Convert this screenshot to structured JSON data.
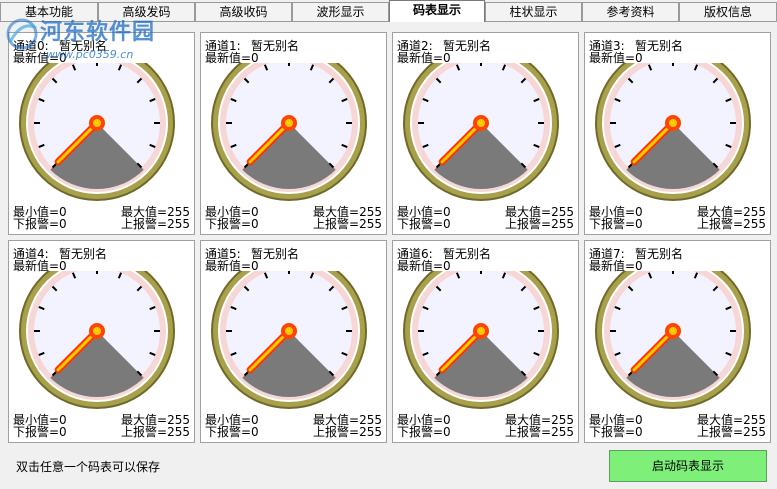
{
  "tabs": [
    {
      "label": "基本功能",
      "active": false
    },
    {
      "label": "高级发码",
      "active": false
    },
    {
      "label": "高级收码",
      "active": false
    },
    {
      "label": "波形显示",
      "active": false
    },
    {
      "label": "码表显示",
      "active": true
    },
    {
      "label": "柱状显示",
      "active": false
    },
    {
      "label": "参考资料",
      "active": false
    },
    {
      "label": "版权信息",
      "active": false
    }
  ],
  "watermark": {
    "title": "河东软件园",
    "url": "www.pc0359.cn"
  },
  "gauges": [
    {
      "channel": "通道0:",
      "alias": "暂无别名",
      "latest": "最新值=0",
      "min": "最小值=0",
      "max": "最大值=255",
      "low_alarm": "下报警=0",
      "high_alarm": "上报警=255",
      "value": 0
    },
    {
      "channel": "通道1:",
      "alias": "暂无别名",
      "latest": "最新值=0",
      "min": "最小值=0",
      "max": "最大值=255",
      "low_alarm": "下报警=0",
      "high_alarm": "上报警=255",
      "value": 0
    },
    {
      "channel": "通道2:",
      "alias": "暂无别名",
      "latest": "最新值=0",
      "min": "最小值=0",
      "max": "最大值=255",
      "low_alarm": "下报警=0",
      "high_alarm": "上报警=255",
      "value": 0
    },
    {
      "channel": "通道3:",
      "alias": "暂无别名",
      "latest": "最新值=0",
      "min": "最小值=0",
      "max": "最大值=255",
      "low_alarm": "下报警=0",
      "high_alarm": "上报警=255",
      "value": 0
    },
    {
      "channel": "通道4:",
      "alias": "暂无别名",
      "latest": "最新值=0",
      "min": "最小值=0",
      "max": "最大值=255",
      "low_alarm": "下报警=0",
      "high_alarm": "上报警=255",
      "value": 0
    },
    {
      "channel": "通道5:",
      "alias": "暂无别名",
      "latest": "最新值=0",
      "min": "最小值=0",
      "max": "最大值=255",
      "low_alarm": "下报警=0",
      "high_alarm": "上报警=255",
      "value": 0
    },
    {
      "channel": "通道6:",
      "alias": "暂无别名",
      "latest": "最新值=0",
      "min": "最小值=0",
      "max": "最大值=255",
      "low_alarm": "下报警=0",
      "high_alarm": "上报警=255",
      "value": 0
    },
    {
      "channel": "通道7:",
      "alias": "暂无别名",
      "latest": "最新值=0",
      "min": "最小值=0",
      "max": "最大值=255",
      "low_alarm": "下报警=0",
      "high_alarm": "上报警=255",
      "value": 0
    }
  ],
  "status": {
    "hint": "双击任意一个码表可以保存",
    "start_button": "启动码表显示"
  },
  "colors": {
    "bezel": "#a8a04a",
    "bezel_dark": "#6e6a2a",
    "dial_face": "#f3f3ff",
    "alarm_band": "#f7d6d6",
    "needle": "#f07000",
    "needle_center": "#ffcc00",
    "sector": "#7a7a7a"
  }
}
